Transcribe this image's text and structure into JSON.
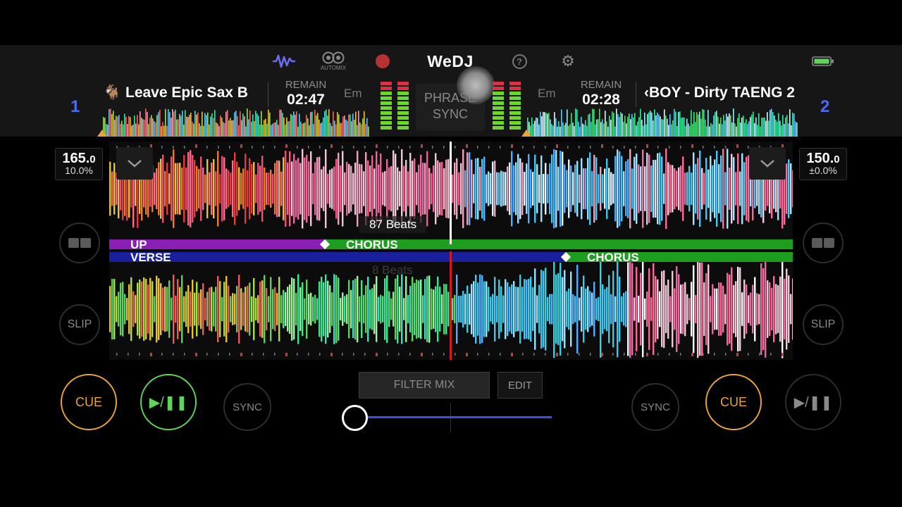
{
  "topbar": {
    "waveform_icon": "waveform-icon",
    "automix_label": "AUTOMIX",
    "record_icon": "record-icon",
    "logo": "WeDJ",
    "help_icon": "help-icon",
    "settings_icon": "gear-icon",
    "battery_icon": "battery-icon"
  },
  "deck1": {
    "number": "1",
    "title": "Leave Epic Sax B",
    "remain_label": "REMAIN",
    "remain_time": "02:47",
    "key": "Em",
    "bpm": "165.",
    "bpm_decimal": "0",
    "pitch": "10.0%",
    "cue_label": "CUE",
    "play_label": "▶/❚❚",
    "sync_label": "SYNC",
    "slip_label": "SLIP",
    "phrase_current": "UP",
    "phrase_next": "CHORUS",
    "beats": "87 Beats"
  },
  "deck2": {
    "number": "2",
    "title": "‹BOY - Dirty TAENG 2",
    "remain_label": "REMAIN",
    "remain_time": "02:28",
    "key": "Em",
    "bpm": "150.",
    "bpm_decimal": "0",
    "pitch": "±0.0%",
    "cue_label": "CUE",
    "play_label": "▶/❚❚",
    "sync_label": "SYNC",
    "slip_label": "SLIP",
    "phrase_current": "VERSE",
    "phrase_next": "CHORUS",
    "beats": "8 Beats"
  },
  "center": {
    "phrase_sync_line1": "PHRASE",
    "phrase_sync_line2": "SYNC",
    "filter_mix_label": "FILTER MIX",
    "edit_label": "EDIT"
  },
  "crossfader": {
    "position_pct": 0
  },
  "colors": {
    "accent_blue": "#3a4fe6",
    "cue_orange": "#e8a33c",
    "play_green": "#5fd35a",
    "phrase_purple": "#8a1fb5",
    "phrase_green": "#1e9e1e",
    "phrase_blue": "#1a1f9e",
    "playhead_white": "#ffffff",
    "playhead_red": "#d41b1b"
  }
}
